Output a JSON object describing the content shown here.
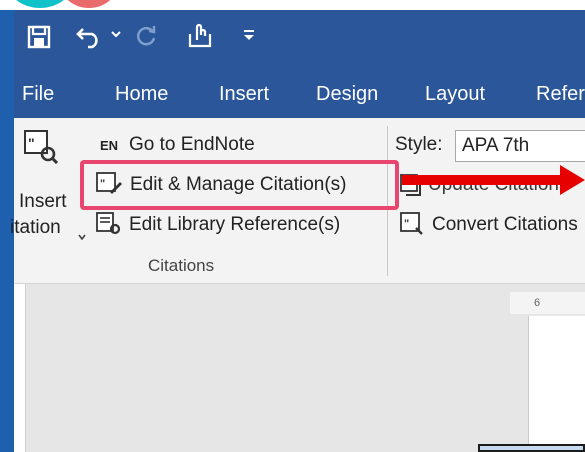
{
  "qat": {
    "save_icon": "save-icon",
    "undo_icon": "undo-icon",
    "redo_icon": "redo-icon",
    "touch_icon": "touch-mode-icon",
    "customize_icon": "customize-qat-icon"
  },
  "tabs": [
    {
      "label": "File"
    },
    {
      "label": "Home"
    },
    {
      "label": "Insert"
    },
    {
      "label": "Design"
    },
    {
      "label": "Layout"
    },
    {
      "label": "Refere"
    }
  ],
  "ribbon": {
    "insert_citation": {
      "line1": "Insert",
      "line2": "itation"
    },
    "goto_endnote": {
      "prefix": "EN",
      "label": "Go to EndNote"
    },
    "edit_manage": {
      "label": "Edit & Manage Citation(s)"
    },
    "edit_library": {
      "label": "Edit Library Reference(s)"
    },
    "group_label": "Citations",
    "style_label": "Style:",
    "style_value": "APA 7th",
    "update_citations": {
      "label": "Update Citations"
    },
    "convert_citations": {
      "label": "Convert Citations"
    }
  },
  "ruler": {
    "label": "6"
  },
  "colors": {
    "accent": "#2b579a",
    "frame": "#1e5fae",
    "highlight": "#e8466f",
    "arrow": "#e60000"
  }
}
